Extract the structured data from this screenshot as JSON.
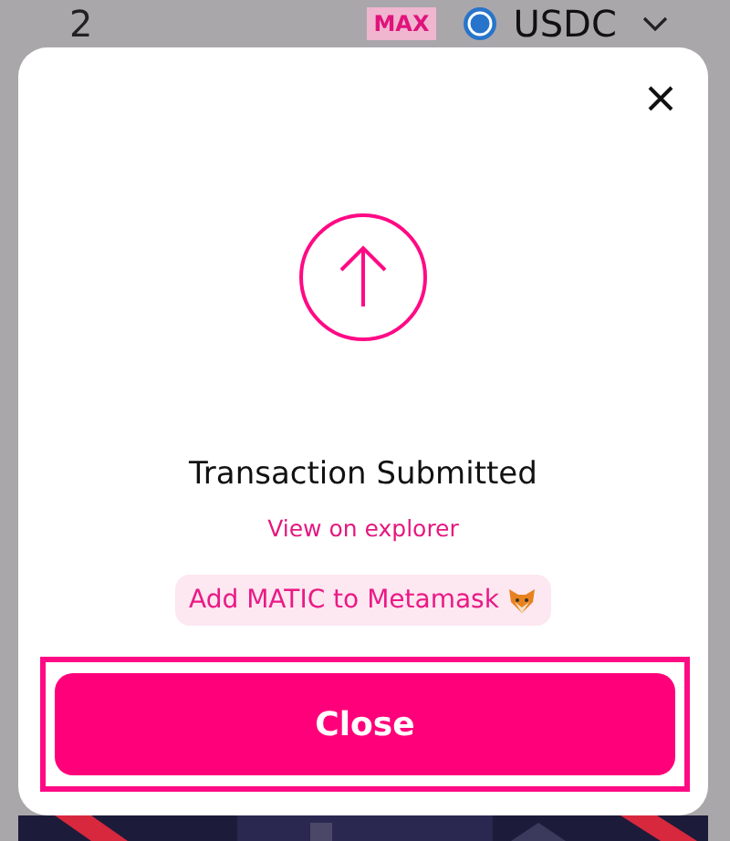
{
  "background_panel": {
    "amount": "2",
    "max_label": "MAX",
    "token": "USDC"
  },
  "modal": {
    "title": "Transaction Submitted",
    "explorer_link": "View on explorer",
    "add_token_button": "Add MATIC to Metamask",
    "close_button": "Close",
    "close_button_highlighted": true
  }
}
